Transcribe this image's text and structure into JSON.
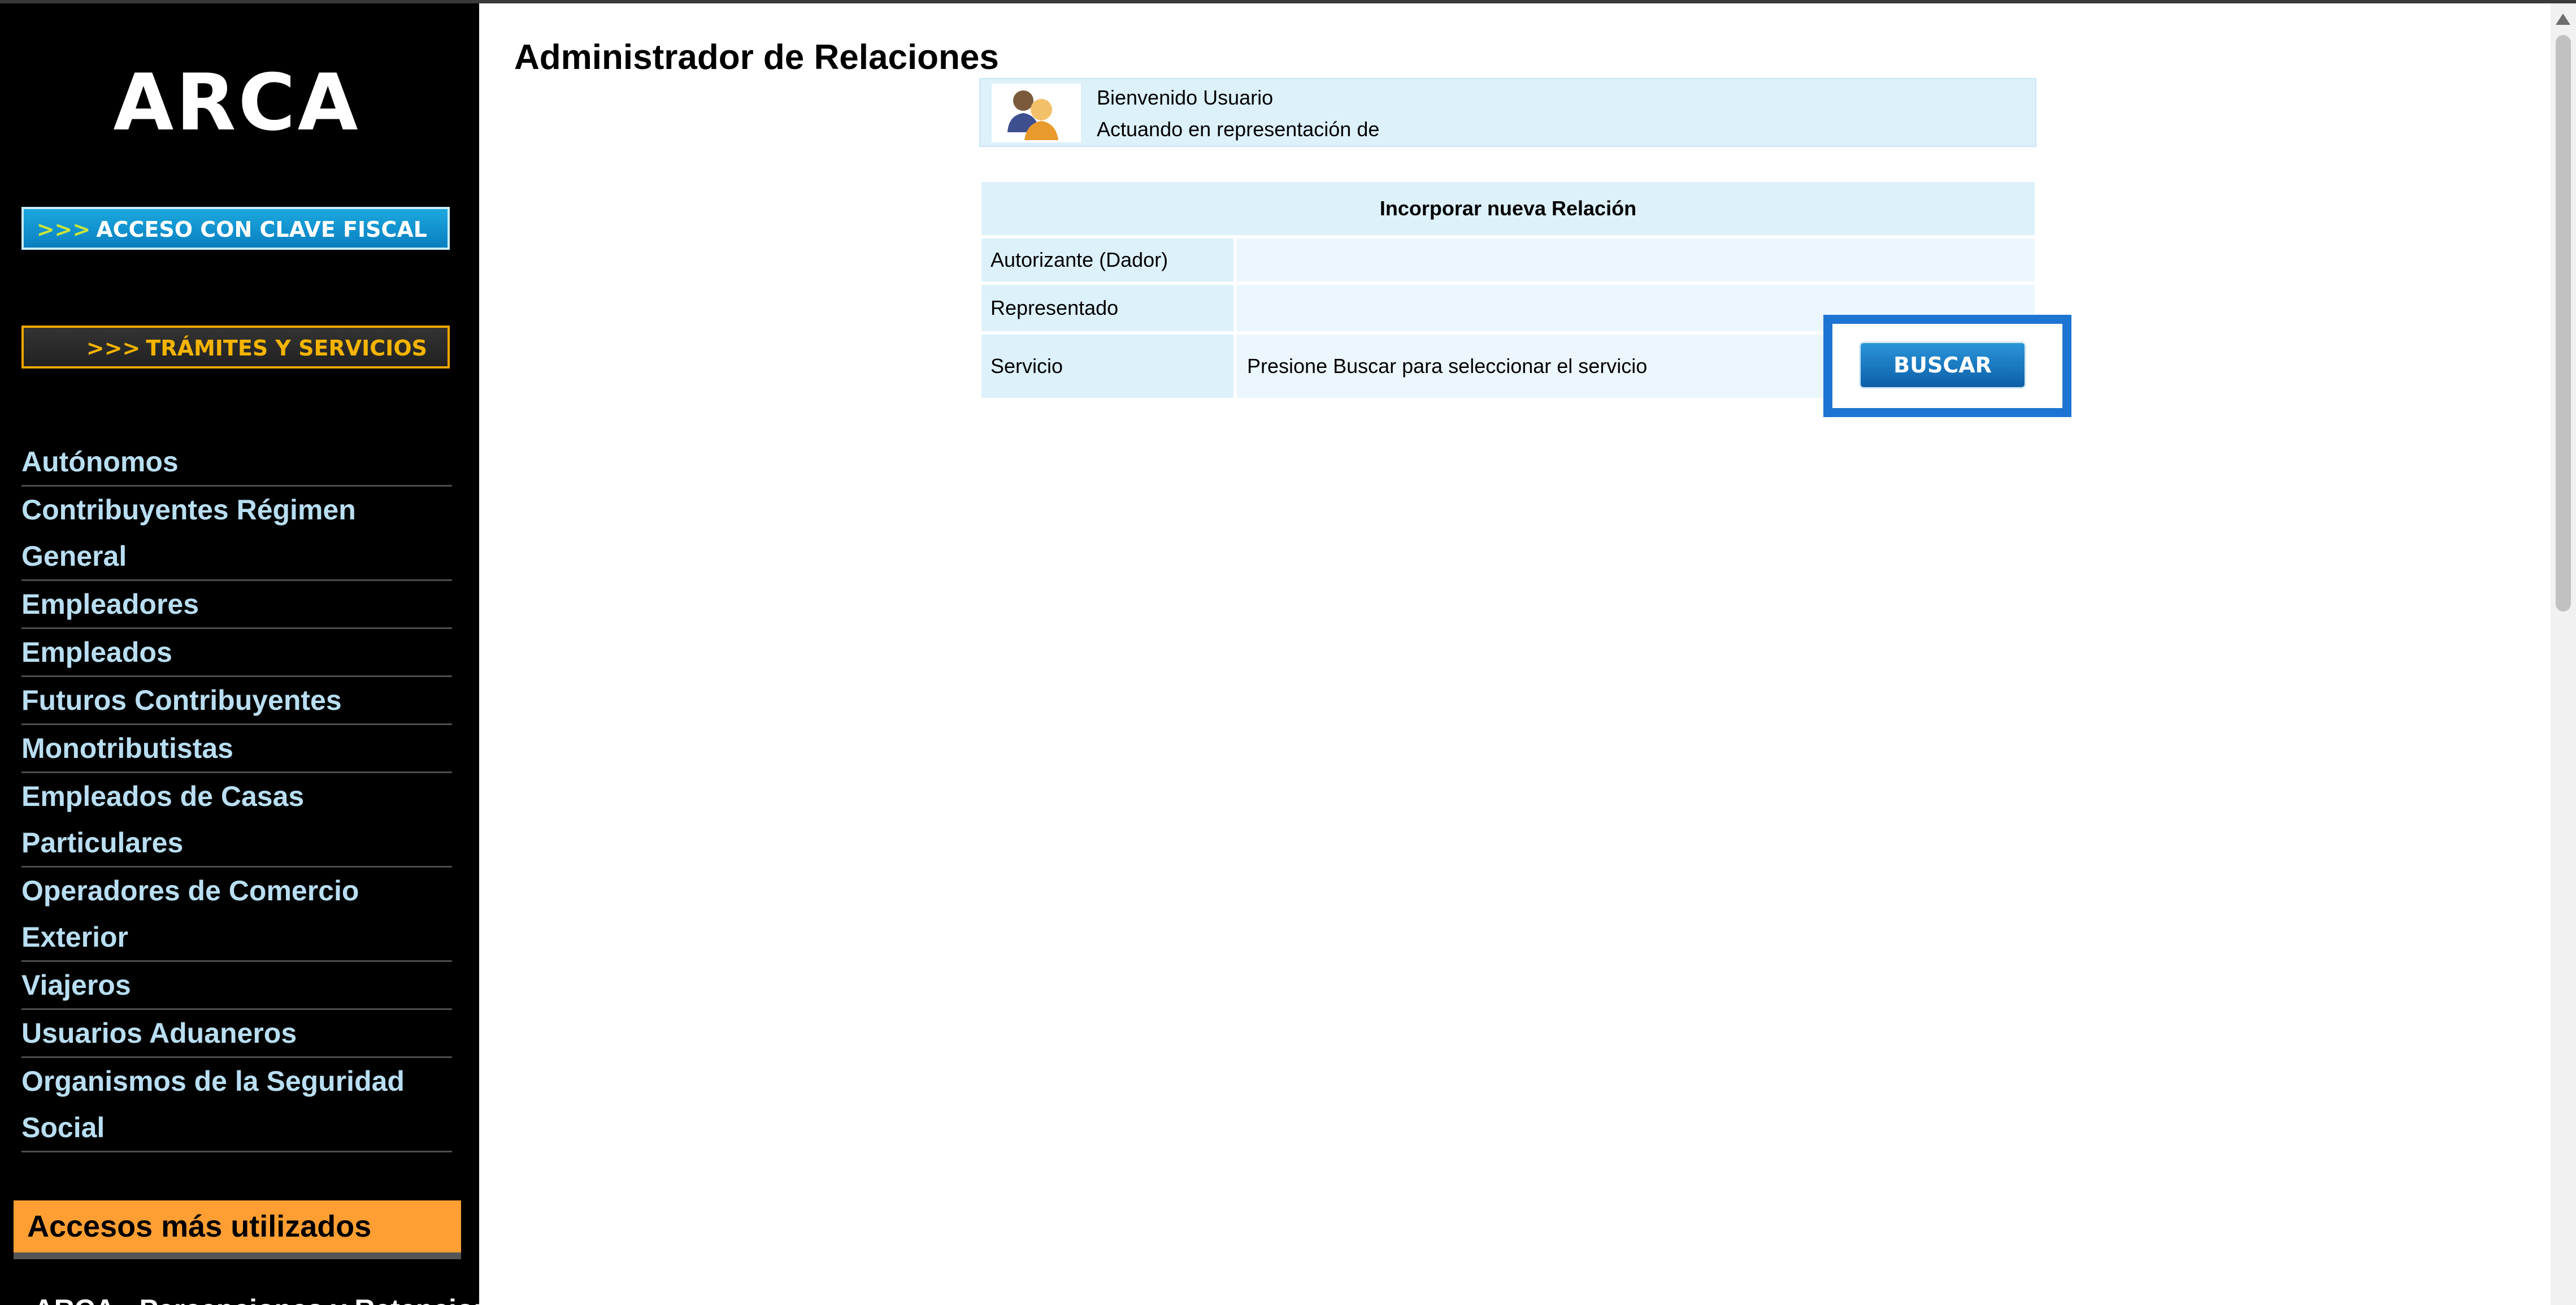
{
  "sidebar": {
    "logo": "ARCA",
    "banner_clave": {
      "arrows": ">>>",
      "label": "ACCESO CON CLAVE FISCAL"
    },
    "banner_tramites": {
      "arrows": ">>>",
      "label": "TRÁMITES Y SERVICIOS"
    },
    "nav_items": [
      "Autónomos",
      "Contribuyentes Régimen General",
      "Empleadores",
      "Empleados",
      "Futuros Contribuyentes",
      "Monotributistas",
      "Empleados de Casas Particulares",
      "Operadores de Comercio Exterior",
      "Viajeros",
      "Usuarios Aduaneros",
      "Organismos de la Seguridad Social"
    ],
    "accesos_label": "Accesos más utilizados",
    "next_link": "• ARCA - Percepciones y Retenciones"
  },
  "main": {
    "title": "Administrador de Relaciones",
    "welcome": {
      "avatar_icon": "users-icon",
      "line1": "Bienvenido Usuario",
      "line2": "Actuando en representación de"
    },
    "panel": {
      "header": "Incorporar nueva Relación",
      "rows": [
        {
          "label": "Autorizante (Dador)",
          "value": ""
        },
        {
          "label": "Representado",
          "value": ""
        },
        {
          "label": "Servicio",
          "value": "Presione Buscar para seleccionar el servicio"
        }
      ]
    },
    "buscar_label": "BUSCAR"
  },
  "colors": {
    "sidebar_bg": "#000000",
    "nav_link": "#b9def2",
    "panel_bg": "#ddf1fb",
    "accent_orange": "#ff9f33",
    "highlight_blue": "#1e74d2",
    "button_blue": "#0d5fa8"
  }
}
